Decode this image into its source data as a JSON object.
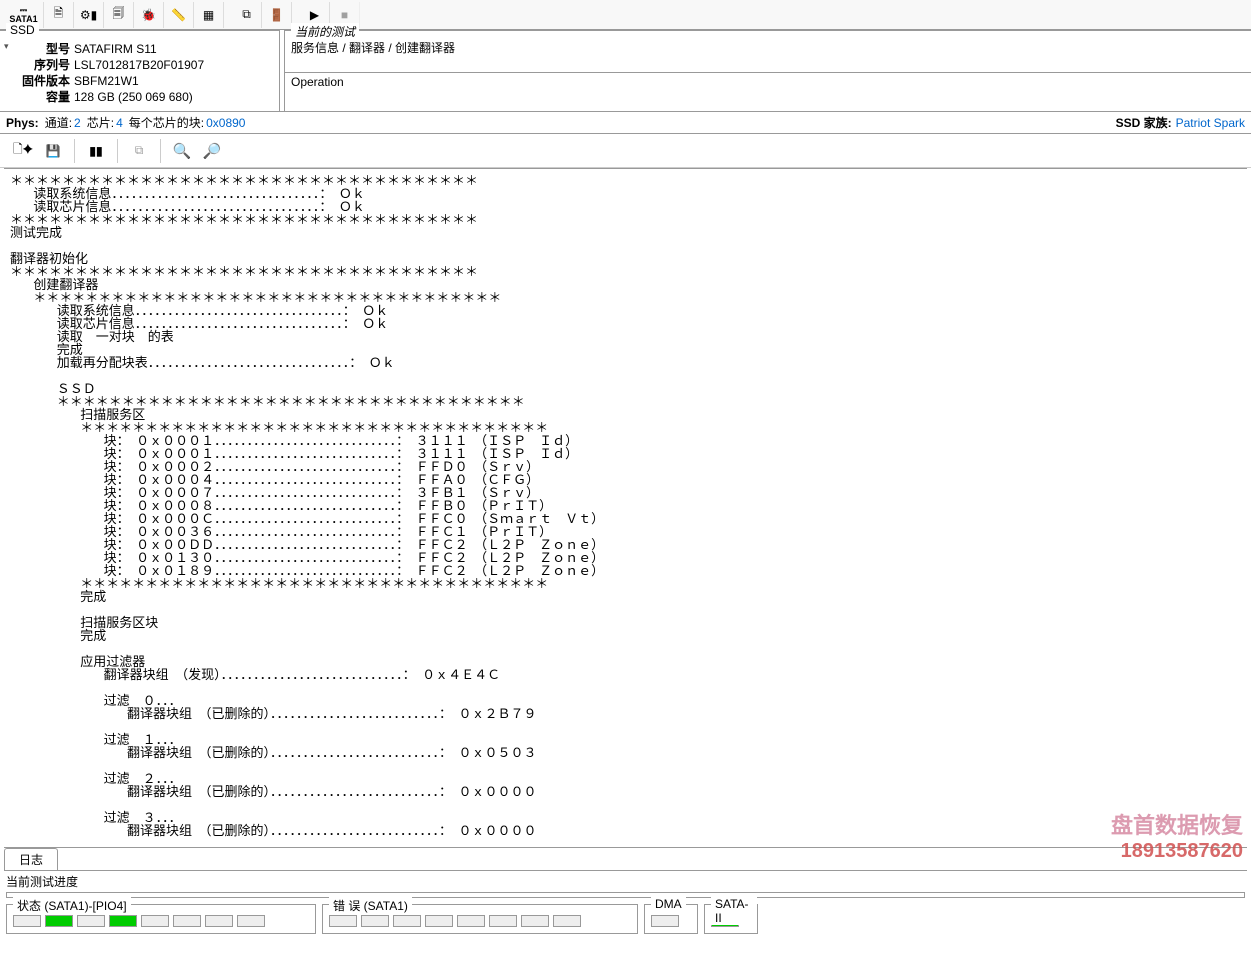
{
  "toolbar_top": {
    "sata_label": "SATA1"
  },
  "ssd_panel": {
    "title": "SSD",
    "model_label": "型号",
    "model_value": "SATAFIRM   S11",
    "serial_label": "序列号",
    "serial_value": "LSL7012817B20F01907",
    "firmware_label": "固件版本",
    "firmware_value": "SBFM21W1",
    "capacity_label": "容量",
    "capacity_value": "128 GB (250 069 680)"
  },
  "current_test": {
    "title": "当前的测试",
    "content": "服务信息 / 翻译器 / 创建翻译器"
  },
  "operation": {
    "label": "Operation"
  },
  "phys_line": {
    "phys_label": "Phys:",
    "channel_label": "通道:",
    "channel_value": "2",
    "chip_label": "芯片:",
    "chip_value": "4",
    "perchip_label": "每个芯片的块:",
    "perchip_value": "0x0890",
    "family_label": "SSD 家族:",
    "family_value": "Patriot Spark"
  },
  "log_text": "＊＊＊＊＊＊＊＊＊＊＊＊＊＊＊＊＊＊＊＊＊＊＊＊＊＊＊＊＊＊＊＊＊＊＊＊\n   读取系统信息．．．．．．．．．．．．．．．．．．．．．．．．．．．．．．．．：　Ｏｋ\n   读取芯片信息．．．．．．．．．．．．．．．．．．．．．．．．．．．．．．．．：　Ｏｋ\n＊＊＊＊＊＊＊＊＊＊＊＊＊＊＊＊＊＊＊＊＊＊＊＊＊＊＊＊＊＊＊＊＊＊＊＊\n测试完成\n\n翻译器初始化\n＊＊＊＊＊＊＊＊＊＊＊＊＊＊＊＊＊＊＊＊＊＊＊＊＊＊＊＊＊＊＊＊＊＊＊＊\n   创建翻译器\n   ＊＊＊＊＊＊＊＊＊＊＊＊＊＊＊＊＊＊＊＊＊＊＊＊＊＊＊＊＊＊＊＊＊＊＊＊\n      读取系统信息．．．．．．．．．．．．．．．．．．．．．．．．．．．．．．．．：　Ｏｋ\n      读取芯片信息．．．．．．．．．．．．．．．．．．．．．．．．．．．．．．．．：　Ｏｋ\n      读取　一对块　的表\n      完成\n      加载再分配块表．．．．．．．．．．．．．．．．．．．．．．．．．．．．．．．：　Ｏｋ\n\n      ＳＳＤ\n      ＊＊＊＊＊＊＊＊＊＊＊＊＊＊＊＊＊＊＊＊＊＊＊＊＊＊＊＊＊＊＊＊＊＊＊＊\n         扫描服务区\n         ＊＊＊＊＊＊＊＊＊＊＊＊＊＊＊＊＊＊＊＊＊＊＊＊＊＊＊＊＊＊＊＊＊＊＊＊\n            块：　０ｘ０００１．．．．．．．．．．．．．．．．．．．．．．．．．．．．：　３１１１　（ＩＳＰ　Ｉｄ）\n            块：　０ｘ０００１．．．．．．．．．．．．．．．．．．．．．．．．．．．．：　３１１１　（ＩＳＰ　Ｉｄ）\n            块：　０ｘ０００２．．．．．．．．．．．．．．．．．．．．．．．．．．．．：　ＦＦＤ０　（Ｓｒｖ）\n            块：　０ｘ０００４．．．．．．．．．．．．．．．．．．．．．．．．．．．．：　ＦＦＡ０　（ＣＦＧ）\n            块：　０ｘ０００７．．．．．．．．．．．．．．．．．．．．．．．．．．．．：　３ＦＢ１　（Ｓｒｖ）\n            块：　０ｘ０００８．．．．．．．．．．．．．．．．．．．．．．．．．．．．：　ＦＦＢ０　（ＰｒＩＴ）\n            块：　０ｘ０００Ｃ．．．．．．．．．．．．．．．．．．．．．．．．．．．．：　ＦＦＣ０　（Ｓｍａｒｔ　Ｖｔ）\n            块：　０ｘ００３６．．．．．．．．．．．．．．．．．．．．．．．．．．．．：　ＦＦＣ１　（ＰｒＩＴ）\n            块：　０ｘ００ＤＤ．．．．．．．．．．．．．．．．．．．．．．．．．．．．：　ＦＦＣ２　（Ｌ２Ｐ　Ｚｏｎｅ）\n            块：　０ｘ０１３０．．．．．．．．．．．．．．．．．．．．．．．．．．．．：　ＦＦＣ２　（Ｌ２Ｐ　Ｚｏｎｅ）\n            块：　０ｘ０１８９．．．．．．．．．．．．．．．．．．．．．．．．．．．．：　ＦＦＣ２　（Ｌ２Ｐ　Ｚｏｎｅ）\n         ＊＊＊＊＊＊＊＊＊＊＊＊＊＊＊＊＊＊＊＊＊＊＊＊＊＊＊＊＊＊＊＊＊＊＊＊\n         完成\n\n         扫描服务区块\n         完成\n\n         应用过滤器\n            翻译器块组　（发现）．．．．．．．．．．．．．．．．．．．．．．．．．．．．：　０ｘ４Ｅ４Ｃ\n\n            过滤　０．．．\n               翻译器块组　（已删除的）．．．．．．．．．．．．．．．．．．．．．．．．．．：　０ｘ２Ｂ７９\n\n            过滤　１．．．\n               翻译器块组　（已删除的）．．．．．．．．．．．．．．．．．．．．．．．．．．：　０ｘ０５０３\n\n            过滤　２．．．\n               翻译器块组　（已删除的）．．．．．．．．．．．．．．．．．．．．．．．．．．：　０ｘ００００\n\n            过滤　３．．．\n               翻译器块组　（已删除的）．．．．．．．．．．．．．．．．．．．．．．．．．．：　０ｘ００００",
  "watermark": {
    "line1": "盘首数据恢复",
    "line2": "18913587620"
  },
  "tabs": {
    "log": "日志"
  },
  "progress": {
    "label": "当前测试进度"
  },
  "status_footer": {
    "status_title": "状态 (SATA1)-[PIO4]",
    "errors_title": "错 误 (SATA1)",
    "dma_title": "DMA",
    "sata2_title": "SATA-II"
  }
}
